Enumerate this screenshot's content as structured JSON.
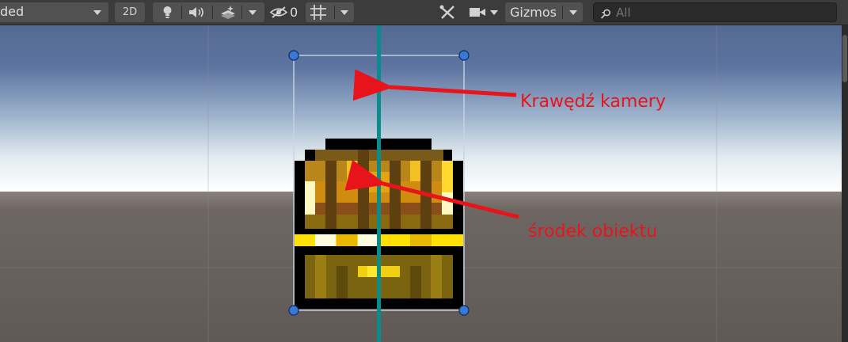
{
  "toolbar": {
    "shading_mode": "ded",
    "view_2d": "2D",
    "hidden_count": "0",
    "gizmos_label": "Gizmos",
    "search_placeholder": "All"
  },
  "annotations": {
    "camera_edge": "Krawędź kamery",
    "object_center": "środek obiektu"
  },
  "colors": {
    "camera_line": "#0a8c8c",
    "arrow": "#e8141c",
    "handle": "#3a78d8",
    "sky_top": "#5a7099",
    "ground": "#6a6360"
  },
  "icons": {
    "light": "lightbulb-icon",
    "audio": "speaker-icon",
    "effects": "effects-icon",
    "visibility": "eye-slash-icon",
    "grid": "grid-icon",
    "tools": "tools-icon",
    "camera": "camera-icon",
    "search": "search-icon"
  }
}
